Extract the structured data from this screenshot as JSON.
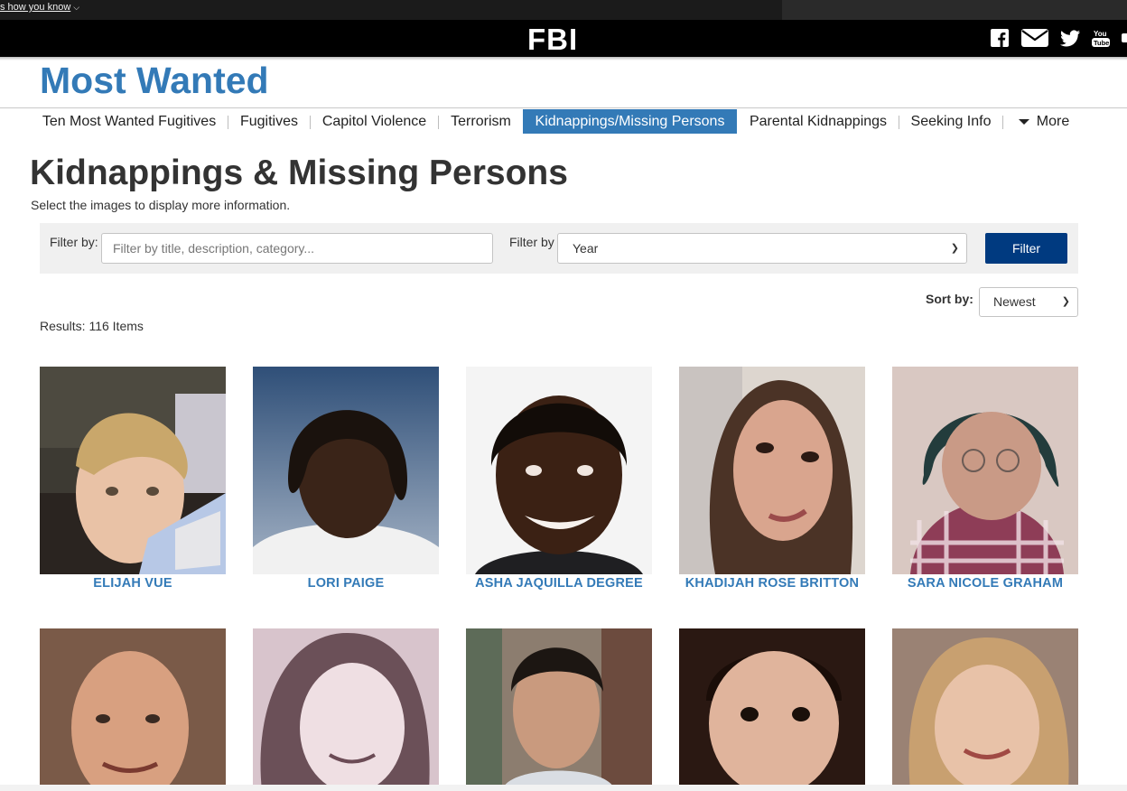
{
  "gov_banner": {
    "how_you_know": "s how you know"
  },
  "header": {
    "logo": "FBI",
    "social_icons": [
      "facebook-icon",
      "email-icon",
      "twitter-icon",
      "youtube-icon"
    ]
  },
  "site_title": "Most Wanted",
  "nav": {
    "items": [
      {
        "label": "Ten Most Wanted Fugitives",
        "active": false
      },
      {
        "label": "Fugitives",
        "active": false
      },
      {
        "label": "Capitol Violence",
        "active": false
      },
      {
        "label": "Terrorism",
        "active": false
      },
      {
        "label": "Kidnappings/Missing Persons",
        "active": true
      },
      {
        "label": "Parental Kidnappings",
        "active": false
      },
      {
        "label": "Seeking Info",
        "active": false
      }
    ],
    "more_label": "More"
  },
  "page": {
    "title": "Kidnappings & Missing Persons",
    "subtitle": "Select the images to display more information."
  },
  "filters": {
    "text_label": "Filter by:",
    "text_placeholder": "Filter by title, description, category...",
    "year_label": "Filter by",
    "year_value": "Year",
    "button_label": "Filter"
  },
  "sort": {
    "label": "Sort by:",
    "value": "Newest"
  },
  "results": {
    "text": "Results: 116 Items"
  },
  "people": [
    {
      "name": "ELIJAH VUE"
    },
    {
      "name": "LORI PAIGE"
    },
    {
      "name": "ASHA JAQUILLA DEGREE"
    },
    {
      "name": "KHADIJAH ROSE BRITTON"
    },
    {
      "name": "SARA NICOLE GRAHAM"
    },
    {
      "name": ""
    },
    {
      "name": ""
    },
    {
      "name": ""
    },
    {
      "name": ""
    },
    {
      "name": ""
    }
  ],
  "colors": {
    "accent": "#337ab7",
    "filter_button": "#003a80",
    "header_bg": "#000000"
  }
}
